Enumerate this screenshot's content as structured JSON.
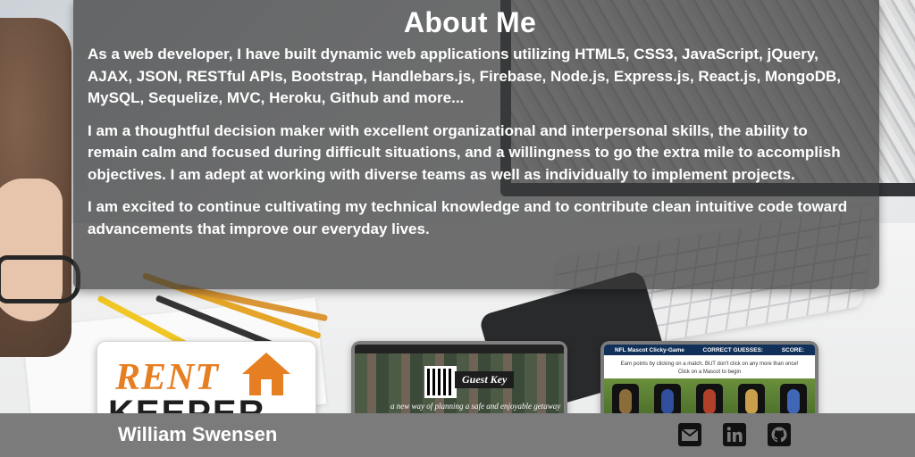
{
  "about": {
    "title": "About Me",
    "paragraphs": [
      "As a web developer, I have built dynamic web applications utilizing HTML5, CSS3, JavaScript, jQuery, AJAX, JSON, RESTful APIs, Bootstrap, Handlebars.js, Firebase, Node.js, Express.js, React.js, MongoDB, MySQL, Sequelize, MVC, Heroku, Github and more...",
      "I am a thoughtful decision maker with excellent organizational and interpersonal skills, the ability to remain calm and focused during difficult situations, and a willingness to go the extra mile to accomplish objectives. I am adept at working with diverse teams as well as individually to implement projects.",
      "I am excited to continue cultivating my technical knowledge and to contribute clean intuitive code toward advancements that improve our everyday lives."
    ]
  },
  "projects": {
    "rent_keeper": {
      "logo_top": "RENT",
      "logo_bottom": "KEEPER"
    },
    "guest_key": {
      "title": "Guest Key",
      "subtitle": "a new way of planning a safe and enjoyable getaway"
    },
    "nfl": {
      "title": "NFL Mascot Clicky-Game",
      "correct_label": "CORRECT GUESSES:",
      "score_label": "SCORE:",
      "instructions": "Earn points by clicking on a match, BUT don't click on any more than once!",
      "prompt": "Click on a Mascot to begin"
    }
  },
  "footer": {
    "name": "William Swensen",
    "icons": [
      "envelope-icon",
      "linkedin-icon",
      "github-icon"
    ]
  },
  "colors": {
    "panel_bg": "rgba(58,58,58,0.72)",
    "footer_bg": "#7b7b7b",
    "text": "#ffffff",
    "rent_orange": "#e67e22",
    "nfl_navy": "#10305a"
  }
}
